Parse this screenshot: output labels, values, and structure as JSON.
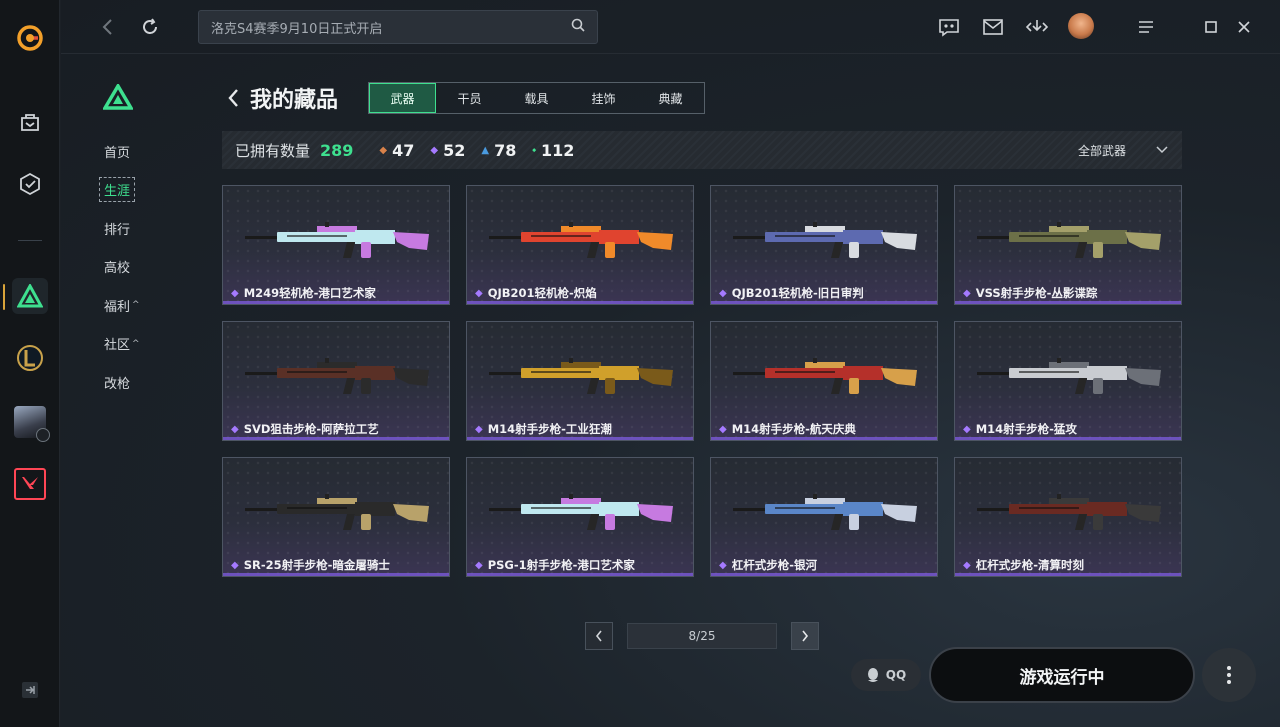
{
  "search": {
    "placeholder": "洛克S4赛季9月10日正式开启"
  },
  "sidebar": {
    "items": [
      {
        "label": "首页",
        "caret": ""
      },
      {
        "label": "生涯",
        "caret": ""
      },
      {
        "label": "排行",
        "caret": ""
      },
      {
        "label": "高校",
        "caret": ""
      },
      {
        "label": "福利",
        "caret": "^"
      },
      {
        "label": "社区",
        "caret": "^"
      },
      {
        "label": "改枪",
        "caret": ""
      }
    ]
  },
  "header": {
    "title": "我的藏品"
  },
  "tabs": [
    {
      "label": "武器",
      "active": true
    },
    {
      "label": "干员",
      "active": false
    },
    {
      "label": "载具",
      "active": false
    },
    {
      "label": "挂饰",
      "active": false
    },
    {
      "label": "典藏",
      "active": false
    }
  ],
  "stats": {
    "owned_label": "已拥有数量",
    "owned_total": "289",
    "tiers": [
      {
        "color": "#d9824a",
        "value": "47"
      },
      {
        "color": "#a57aff",
        "value": "52"
      },
      {
        "color": "#4a9be0",
        "value": "78"
      },
      {
        "color": "#3ee08f",
        "value": "112"
      }
    ],
    "filter_label": "全部武器"
  },
  "items": [
    {
      "name": "M249轻机枪-港口艺术家",
      "accent": "#bfe8ef",
      "accent2": "#c67ae0"
    },
    {
      "name": "QJB201轻机枪-炽焰",
      "accent": "#e0442f",
      "accent2": "#f08a2a"
    },
    {
      "name": "QJB201轻机枪-旧日审判",
      "accent": "#5d6ab0",
      "accent2": "#d8dbe0"
    },
    {
      "name": "VSS射手步枪-丛影谍踪",
      "accent": "#6c7048",
      "accent2": "#a4a06a"
    },
    {
      "name": "SVD狙击步枪-阿萨拉工艺",
      "accent": "#5a3026",
      "accent2": "#2b2b2b"
    },
    {
      "name": "M14射手步枪-工业狂潮",
      "accent": "#d0a02b",
      "accent2": "#7a5a1a"
    },
    {
      "name": "M14射手步枪-航天庆典",
      "accent": "#b5302a",
      "accent2": "#d7a04a"
    },
    {
      "name": "M14射手步枪-猛攻",
      "accent": "#c9ccd1",
      "accent2": "#6c7078"
    },
    {
      "name": "SR-25射手步枪-暗金屠骑士",
      "accent": "#2a2a2a",
      "accent2": "#b8a26a"
    },
    {
      "name": "PSG-1射手步枪-港口艺术家",
      "accent": "#bfe8ef",
      "accent2": "#c67ae0"
    },
    {
      "name": "杠杆式步枪-银河",
      "accent": "#5a86c8",
      "accent2": "#c8d0e0"
    },
    {
      "name": "杠杆式步枪-清算时刻",
      "accent": "#6a2a22",
      "accent2": "#3a3a3a"
    }
  ],
  "pagination": {
    "current": "8/25"
  },
  "footer": {
    "qq_label": "QQ",
    "launch_label": "游戏运行中"
  }
}
